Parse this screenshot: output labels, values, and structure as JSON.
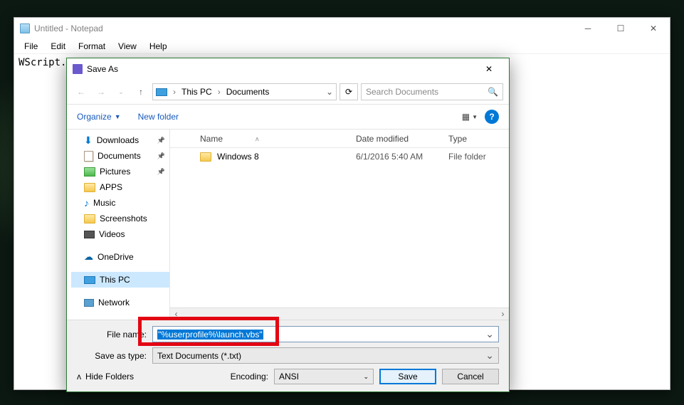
{
  "notepad": {
    "title": "Untitled - Notepad",
    "menu": [
      "File",
      "Edit",
      "Format",
      "View",
      "Help"
    ],
    "content": "WScript.CreateObject(\"Wscript.Shell\").Run \"C:\\Apps\""
  },
  "saveas": {
    "title": "Save As",
    "breadcrumb": {
      "root": "This PC",
      "folder": "Documents"
    },
    "search_placeholder": "Search Documents",
    "toolbar": {
      "organize": "Organize",
      "newfolder": "New folder"
    },
    "tree": [
      {
        "icon": "dl",
        "label": "Downloads",
        "pinned": true
      },
      {
        "icon": "doc",
        "label": "Documents",
        "pinned": true
      },
      {
        "icon": "pic",
        "label": "Pictures",
        "pinned": true
      },
      {
        "icon": "folder",
        "label": "APPS"
      },
      {
        "icon": "music",
        "label": "Music"
      },
      {
        "icon": "folder",
        "label": "Screenshots"
      },
      {
        "icon": "vid",
        "label": "Videos"
      }
    ],
    "tree2": [
      {
        "icon": "onedrive",
        "label": "OneDrive"
      }
    ],
    "tree3": [
      {
        "icon": "monitor",
        "label": "This PC",
        "selected": true
      }
    ],
    "tree4": [
      {
        "icon": "net",
        "label": "Network"
      }
    ],
    "columns": {
      "name": "Name",
      "date": "Date modified",
      "type": "Type"
    },
    "rows": [
      {
        "name": "Windows 8",
        "date": "6/1/2016 5:40 AM",
        "type": "File folder"
      }
    ],
    "filename_label": "File name:",
    "filename_value": "\"%userprofile%\\launch.vbs\"",
    "saveastype_label": "Save as type:",
    "saveastype_value": "Text Documents (*.txt)",
    "hide_folders": "Hide Folders",
    "encoding_label": "Encoding:",
    "encoding_value": "ANSI",
    "save_btn": "Save",
    "cancel_btn": "Cancel"
  }
}
